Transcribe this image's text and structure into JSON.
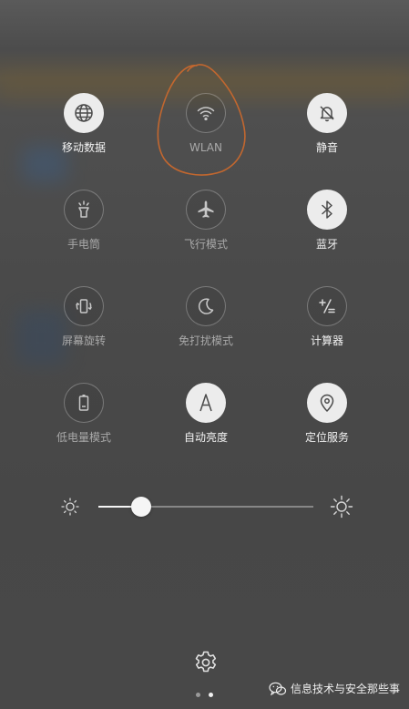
{
  "colors": {
    "active_circle": "#ececec",
    "active_icon": "#4a4a4a",
    "inactive_icon": "#c8c8c8",
    "annotation_stroke": "#c2672f"
  },
  "tiles": [
    {
      "label": "移动数据",
      "icon": "globe-icon",
      "active": true
    },
    {
      "label": "WLAN",
      "icon": "wifi-icon",
      "active": false
    },
    {
      "label": "静音",
      "icon": "bell-muted-icon",
      "active": true
    },
    {
      "label": "手电筒",
      "icon": "flashlight-icon",
      "active": false
    },
    {
      "label": "飞行模式",
      "icon": "airplane-icon",
      "active": false
    },
    {
      "label": "蓝牙",
      "icon": "bluetooth-icon",
      "active": true
    },
    {
      "label": "屏幕旋转",
      "icon": "rotate-screen-icon",
      "active": false
    },
    {
      "label": "免打扰模式",
      "icon": "moon-icon",
      "active": false
    },
    {
      "label": "计算器",
      "icon": "calculator-icon",
      "active": true
    },
    {
      "label": "低电量模式",
      "icon": "battery-icon",
      "active": false
    },
    {
      "label": "自动亮度",
      "icon": "auto-brightness-icon",
      "active": true
    },
    {
      "label": "定位服务",
      "icon": "location-pin-icon",
      "active": true
    }
  ],
  "brightness": {
    "level": 0.2
  },
  "pager": {
    "pages": 2,
    "current": 2
  },
  "watermark": {
    "text": "信息技术与安全那些事",
    "icon": "wechat-icon"
  }
}
